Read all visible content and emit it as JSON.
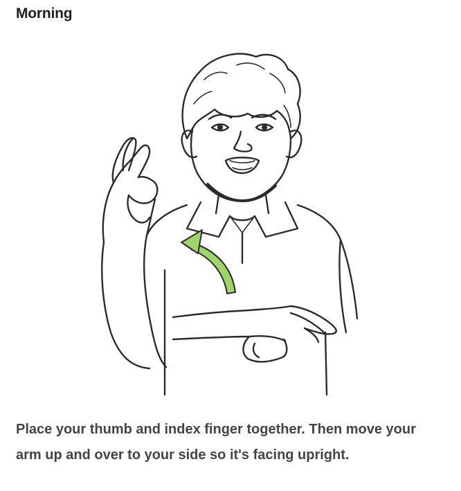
{
  "title": "Morning",
  "illustration": {
    "subject": "person-signing-morning",
    "arrow_color": "#9fd46b"
  },
  "caption": "Place your thumb and index finger together. Then move your arm up and over to your side so it's facing upright."
}
